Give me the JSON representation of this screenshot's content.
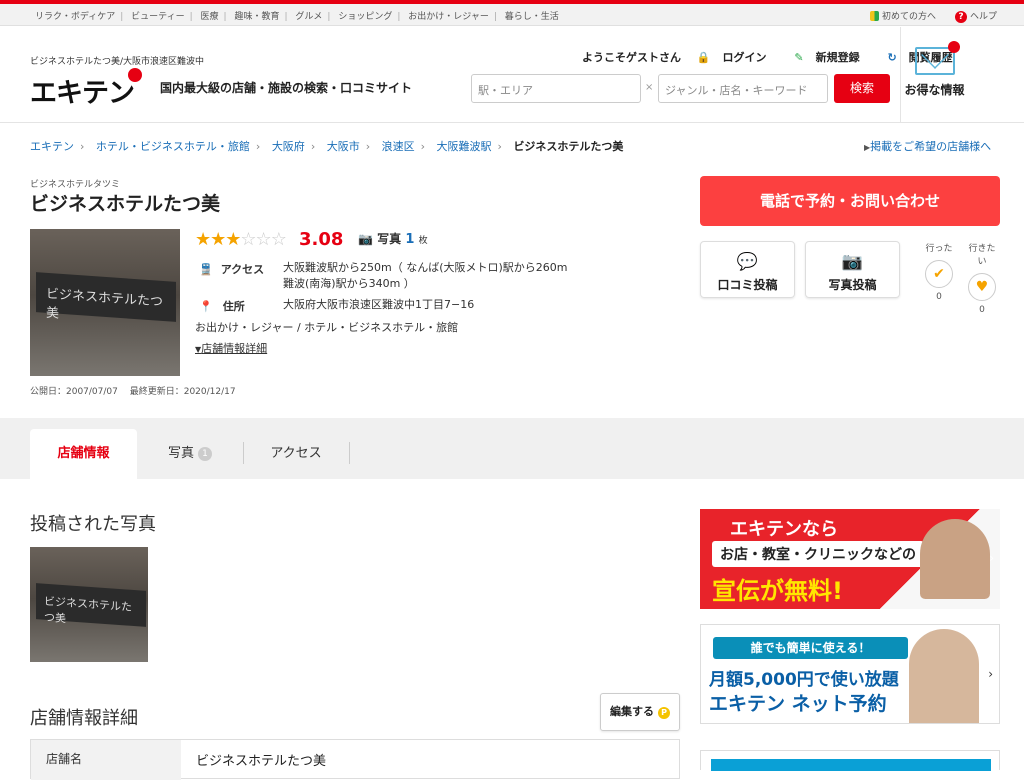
{
  "topnav": {
    "categories": [
      "リラク・ボディケア",
      "ビューティー",
      "医療",
      "趣味・教育",
      "グルメ",
      "ショッピング",
      "お出かけ・レジャー",
      "暮らし・生活"
    ],
    "first_time": "初めての方へ",
    "help": "ヘルプ"
  },
  "header": {
    "subtitle": "ビジネスホテルたつ美/大阪市浪速区難波中",
    "logo": "エキテン",
    "tagline": "国内最大級の店舗・施設の検索・口コミサイト",
    "welcome": "ようこそゲストさん",
    "login": "ログイン",
    "register": "新規登録",
    "history": "閲覧履歴",
    "search_station_placeholder": "駅・エリア",
    "search_keyword_placeholder": "ジャンル・店名・キーワード",
    "clear_mark": "×",
    "search_button": "検索",
    "deal_label": "お得な情報"
  },
  "breadcrumb": {
    "items": [
      "エキテン",
      "ホテル・ビジネスホテル・旅館",
      "大阪府",
      "大阪市",
      "浪速区",
      "大阪難波駅"
    ],
    "current": "ビジネスホテルたつ美",
    "sep": "›",
    "keisai": "掲載をご希望の店舗様へ"
  },
  "shop": {
    "kana": "ビジネスホテルタツミ",
    "name": "ビジネスホテルたつ美",
    "sign_text": "ビジネスホテルたつ美",
    "stars_filled": "★★★",
    "stars_empty": "☆☆☆",
    "rating_value": 3.08,
    "score": "3.08",
    "photo_label": "写真",
    "photo_count": "1",
    "photo_unit": "枚",
    "access_label": "アクセス",
    "access_line1": "大阪難波駅から250m（ なんば(大阪メトロ)駅から260m",
    "access_line2": "難波(南海)駅から340m ）",
    "address_label": "住所",
    "address": "大阪府大阪市浪速区難波中1丁目7−16",
    "genre": "お出かけ・レジャー /  ホテル・ビジネスホテル・旅館",
    "details_link": "店舗情報詳細",
    "dates": "公開日：2007/07/07　 最終更新日：2020/12/17"
  },
  "actions": {
    "call": "電話で予約・お問い合わせ",
    "review": "口コミ投稿",
    "photo": "写真投稿",
    "went_label": "行った",
    "went_count": "0",
    "want_label": "行きたい",
    "want_count": "0"
  },
  "tabs": {
    "info": "店舗情報",
    "photos": "写真",
    "photos_count": "1",
    "access": "アクセス"
  },
  "main": {
    "photos_title": "投稿された写真",
    "details_title": "店舗情報詳細",
    "edit_button": "編集する",
    "edit_point": "P",
    "table_header": "店舗名",
    "table_value": "ビジネスホテルたつ美"
  },
  "banners": {
    "b1_line1": "エキテンなら",
    "b1_line2": "お店・教室・クリニックなどの",
    "b1_line3": "宣伝が無料!",
    "b2_line1": "誰でも簡単に使える！",
    "b2_line2": "月額5,000円で使い放題",
    "b2_line3": "エキテン ネット予約"
  },
  "colors": {
    "accent": "#e60012",
    "link": "#1a6eb7",
    "call": "#fc4040"
  }
}
